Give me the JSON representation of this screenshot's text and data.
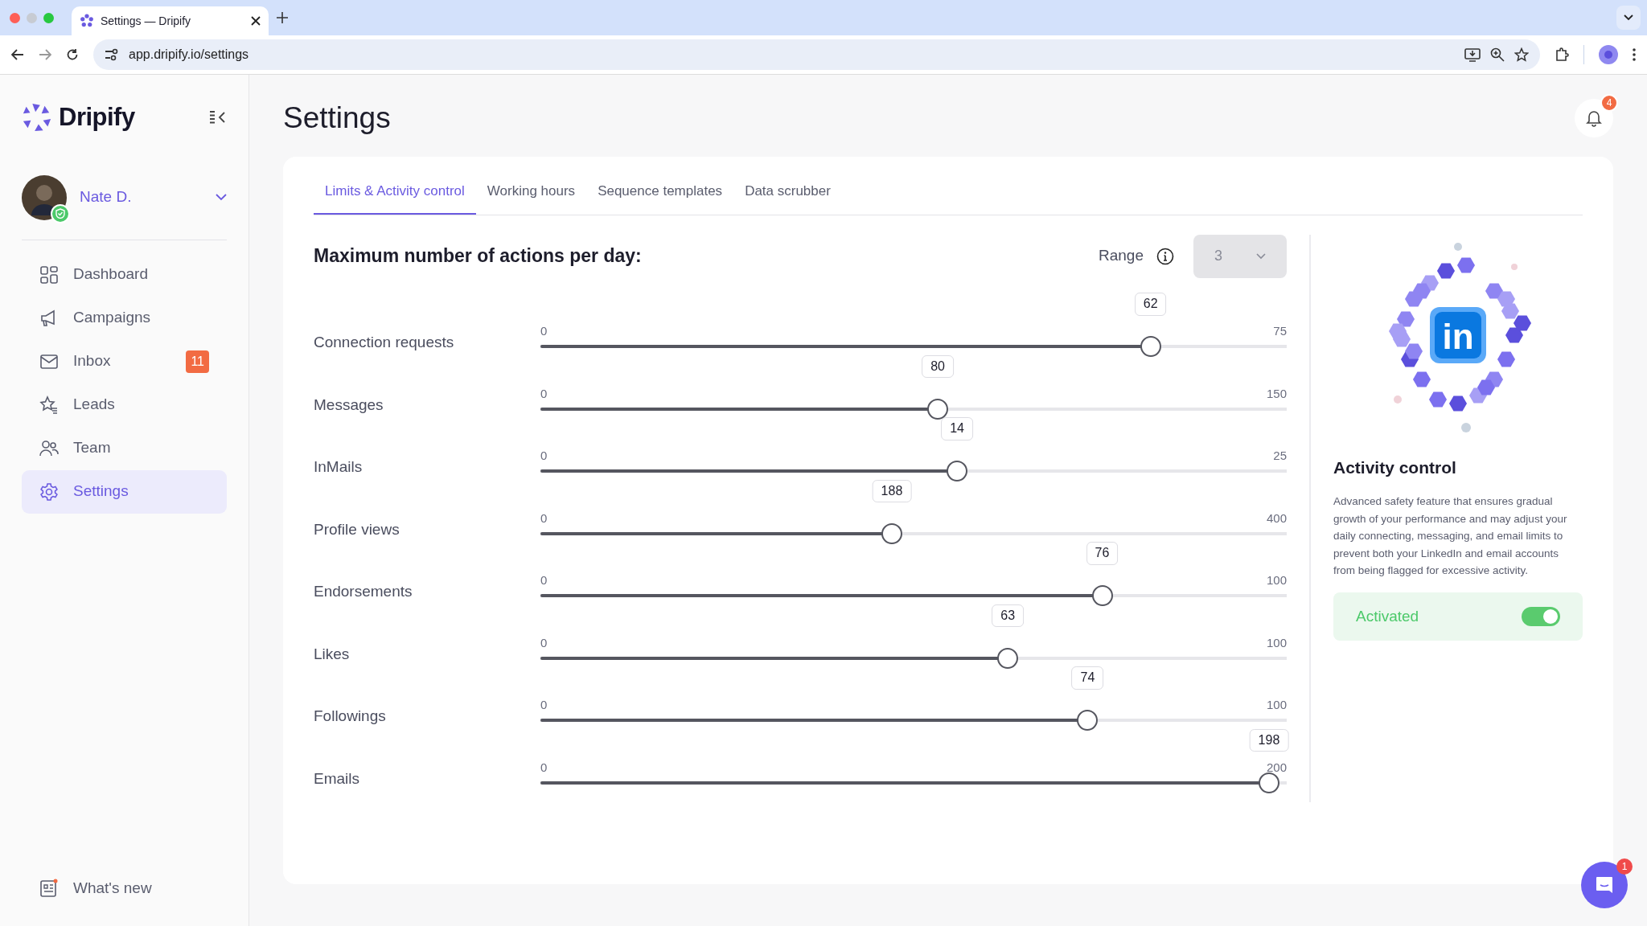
{
  "browser": {
    "tab_title": "Settings — Dripify",
    "url": "app.dripify.io/settings"
  },
  "sidebar": {
    "brand": "Dripify",
    "user": {
      "name": "Nate D.",
      "verified": true
    },
    "items": [
      {
        "label": "Dashboard",
        "selected": false
      },
      {
        "label": "Campaigns",
        "selected": false
      },
      {
        "label": "Inbox",
        "selected": false,
        "badge": "11"
      },
      {
        "label": "Leads",
        "selected": false
      },
      {
        "label": "Team",
        "selected": false
      },
      {
        "label": "Settings",
        "selected": true
      }
    ],
    "footer": {
      "label": "What's new"
    }
  },
  "header": {
    "title": "Settings",
    "notification_count": "4"
  },
  "tabs": [
    {
      "label": "Limits & Activity control",
      "selected": true
    },
    {
      "label": "Working hours",
      "selected": false
    },
    {
      "label": "Sequence templates",
      "selected": false
    },
    {
      "label": "Data scrubber",
      "selected": false
    }
  ],
  "limits": {
    "title": "Maximum number of actions per day:",
    "range_label": "Range",
    "range_value": "3",
    "sliders": [
      {
        "name": "Connection requests",
        "min": "0",
        "max": "75",
        "value": "62",
        "level": 0.8267
      },
      {
        "name": "Messages",
        "min": "0",
        "max": "150",
        "value": "80",
        "level": 0.5333
      },
      {
        "name": "InMails",
        "min": "0",
        "max": "25",
        "value": "14",
        "level": 0.56
      },
      {
        "name": "Profile views",
        "min": "0",
        "max": "400",
        "value": "188",
        "level": 0.47
      },
      {
        "name": "Endorsements",
        "min": "0",
        "max": "100",
        "value": "76",
        "level": 0.76
      },
      {
        "name": "Likes",
        "min": "0",
        "max": "100",
        "value": "63",
        "level": 0.63
      },
      {
        "name": "Followings",
        "min": "0",
        "max": "100",
        "value": "74",
        "level": 0.74
      },
      {
        "name": "Emails",
        "min": "0",
        "max": "200",
        "value": "198",
        "level": 0.99
      }
    ]
  },
  "activity_control": {
    "badge_text": "in",
    "title": "Activity control",
    "description": "Advanced safety feature that ensures gradual growth of your performance and may adjust your daily connecting, messaging, and email limits to prevent both your LinkedIn and email accounts from being flagged for excessive activity.",
    "toggle": {
      "label": "Activated",
      "on": true
    }
  },
  "chat": {
    "badge": "1"
  }
}
